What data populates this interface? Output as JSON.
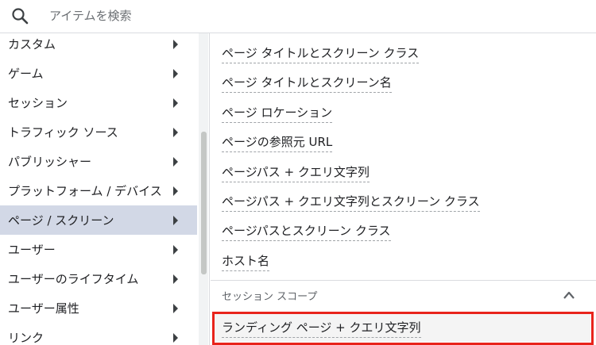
{
  "search": {
    "placeholder": "アイテムを検索",
    "icon": "search-icon"
  },
  "categories": [
    {
      "label": "カスタム",
      "active": false
    },
    {
      "label": "ゲーム",
      "active": false
    },
    {
      "label": "セッション",
      "active": false
    },
    {
      "label": "トラフィック ソース",
      "active": false
    },
    {
      "label": "パブリッシャー",
      "active": false
    },
    {
      "label": "プラットフォーム / デバイス",
      "active": false
    },
    {
      "label": "ページ / スクリーン",
      "active": true
    },
    {
      "label": "ユーザー",
      "active": false
    },
    {
      "label": "ユーザーのライフタイム",
      "active": false
    },
    {
      "label": "ユーザー属性",
      "active": false
    },
    {
      "label": "リンク",
      "active": false
    }
  ],
  "dimensions": [
    "ページ タイトルとスクリーン クラス",
    "ページ タイトルとスクリーン名",
    "ページ ロケーション",
    "ページの参照元 URL",
    "ページパス + クエリ文字列",
    "ページパス + クエリ文字列とスクリーン クラス",
    "ページパスとスクリーン クラス",
    "ホスト名"
  ],
  "session_scope": {
    "label": "セッション スコープ",
    "icon": "chevron-up-icon",
    "items": [
      "ランディング ページ + クエリ文字列"
    ]
  },
  "colors": {
    "active_bg": "#d2d8e6",
    "highlight_border": "#e8231b"
  }
}
